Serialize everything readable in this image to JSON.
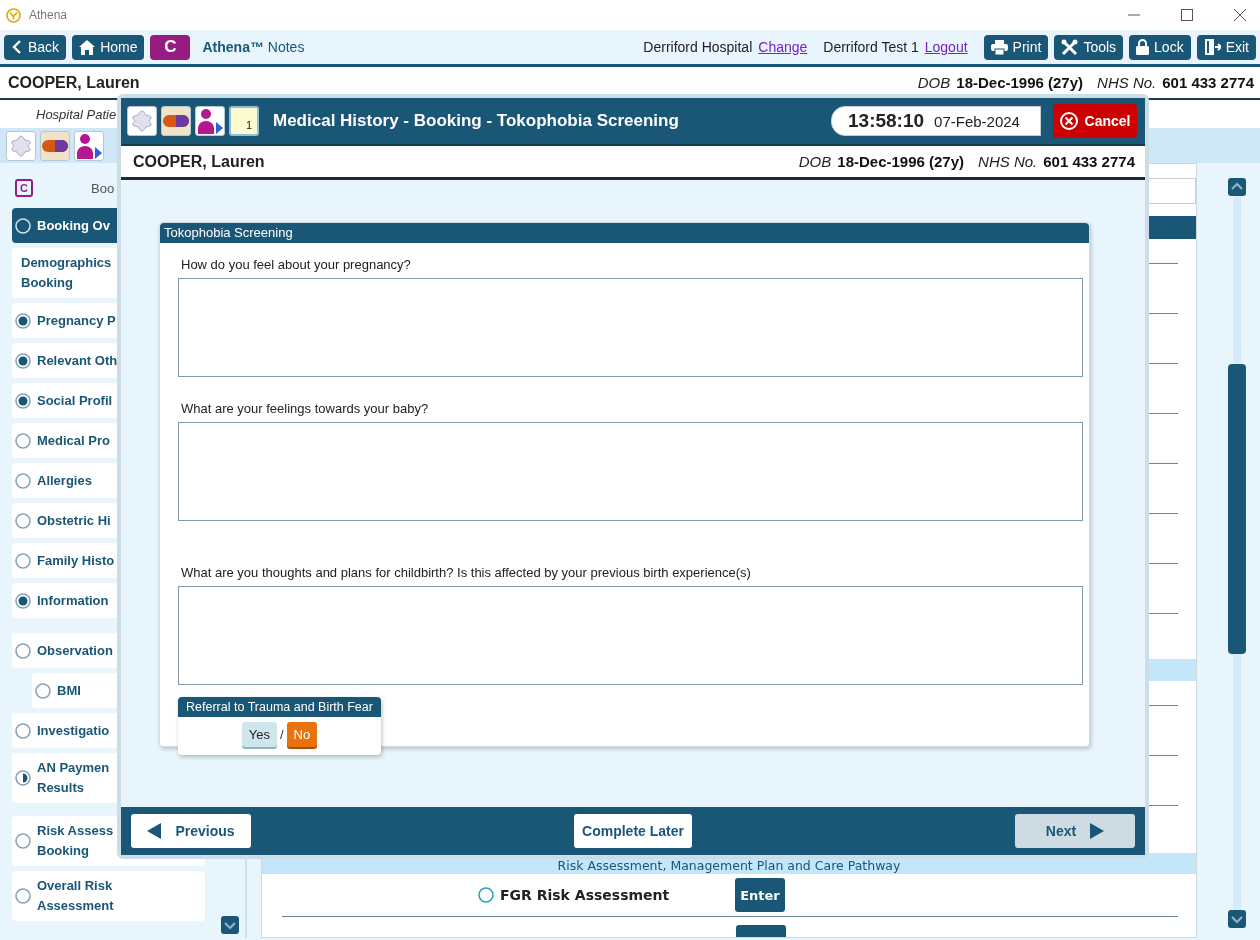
{
  "app_title": "Athena",
  "toolbar": {
    "buttons": [
      {
        "kind": "back",
        "label": "Back"
      },
      {
        "kind": "home",
        "label": "Home"
      },
      {
        "kind": "letter",
        "label": "C"
      }
    ],
    "app_name": "**Athena™** Notes",
    "location": "Derriford Hospital",
    "location_link": "Change",
    "user": "Derriford Test 1",
    "user_link": "Logout",
    "actions": [
      {
        "kind": "print",
        "label": "Print"
      },
      {
        "kind": "tools",
        "label": "Tools"
      },
      {
        "kind": "lock",
        "label": "Lock"
      },
      {
        "kind": "exit",
        "label": "Exit"
      }
    ]
  },
  "patient": {
    "name": "COOPER, Lauren",
    "dob_label": "DOB",
    "dob": "18-Dec-1996 (27y)",
    "nhs_label": "NHS No.",
    "nhs": "601 433 2774"
  },
  "subheader": "Hospital Patie",
  "icon_bar": [
    {
      "kind": "star"
    },
    {
      "kind": "pill"
    },
    {
      "kind": "person"
    }
  ],
  "sidebar": {
    "badge": "C",
    "heading": "Boo",
    "items": [
      {
        "kind": "radio",
        "label": "Booking Ov",
        "checked": false,
        "partial": false,
        "selected": true
      },
      {
        "kind": "plain",
        "label": "Demographics\nBooking",
        "selected": false
      },
      {
        "kind": "radio",
        "label": "Pregnancy P",
        "checked": true,
        "partial": false,
        "selected": false
      },
      {
        "kind": "radio",
        "label": "Relevant Oth",
        "checked": true,
        "partial": false,
        "selected": false
      },
      {
        "kind": "radio",
        "label": "Social Profil",
        "checked": true,
        "partial": false,
        "selected": false
      },
      {
        "kind": "radio",
        "label": "Medical Pro",
        "checked": false,
        "partial": false,
        "selected": false
      },
      {
        "kind": "radio",
        "label": "Allergies",
        "checked": false,
        "partial": false,
        "selected": false
      },
      {
        "kind": "radio",
        "label": "Obstetric Hi",
        "checked": false,
        "partial": false,
        "selected": false
      },
      {
        "kind": "radio",
        "label": "Family Histo",
        "checked": false,
        "partial": false,
        "selected": false
      },
      {
        "kind": "radio",
        "label": "Information",
        "checked": true,
        "partial": false,
        "selected": false
      },
      {
        "kind": "radio",
        "label": "Observation",
        "checked": false,
        "partial": false,
        "selected": false,
        "children": [
          {
            "kind": "radio",
            "label": "BMI",
            "checked": false,
            "partial": false,
            "selected": false
          }
        ]
      },
      {
        "kind": "radio",
        "label": "Investigatio",
        "checked": false,
        "partial": false,
        "selected": false
      },
      {
        "kind": "radio",
        "label": "AN Paymen\nResults",
        "checked": false,
        "partial": true,
        "selected": false
      },
      {
        "kind": "radio",
        "label": "Risk Assess\nBooking",
        "checked": false,
        "partial": false,
        "selected": false
      },
      {
        "kind": "radio",
        "label": "Overall Risk\nAssessment",
        "checked": false,
        "partial": false,
        "selected": false
      }
    ]
  },
  "main": {
    "section_header": "Risk Assessment, Management Plan and Care Pathway",
    "rows": [
      {
        "label": "FGR Risk Assessment",
        "checked": false,
        "button": "Enter"
      }
    ]
  },
  "modal": {
    "icons": [
      {
        "kind": "star"
      },
      {
        "kind": "pill"
      },
      {
        "kind": "person"
      },
      {
        "kind": "notepad",
        "text": "1"
      }
    ],
    "title": "Medical History - Booking - Tokophobia Screening",
    "time": "13:58:10",
    "date": "07-Feb-2024",
    "cancel": "Cancel",
    "patient": {
      "name": "COOPER, Lauren",
      "dob_label": "DOB",
      "dob": "18-Dec-1996 (27y)",
      "nhs_label": "NHS No.",
      "nhs": "601 433 2774"
    },
    "form_title": "Tokophobia Screening",
    "questions": [
      {
        "label": "How do you feel about your pregnancy?"
      },
      {
        "label": "What are your feelings towards your baby?"
      },
      {
        "label": "What are you thoughts and plans for childbirth? Is this affected by your previous birth experience(s)"
      }
    ],
    "referral": {
      "title": "Referral to Trauma and Birth Fear",
      "separator": "/",
      "options": [
        {
          "label": "Yes",
          "selected": false
        },
        {
          "label": "No",
          "selected": true
        }
      ]
    },
    "footer": {
      "previous": "Previous",
      "complete_later": "Complete Later",
      "next": "Next",
      "next_disabled": true
    }
  }
}
